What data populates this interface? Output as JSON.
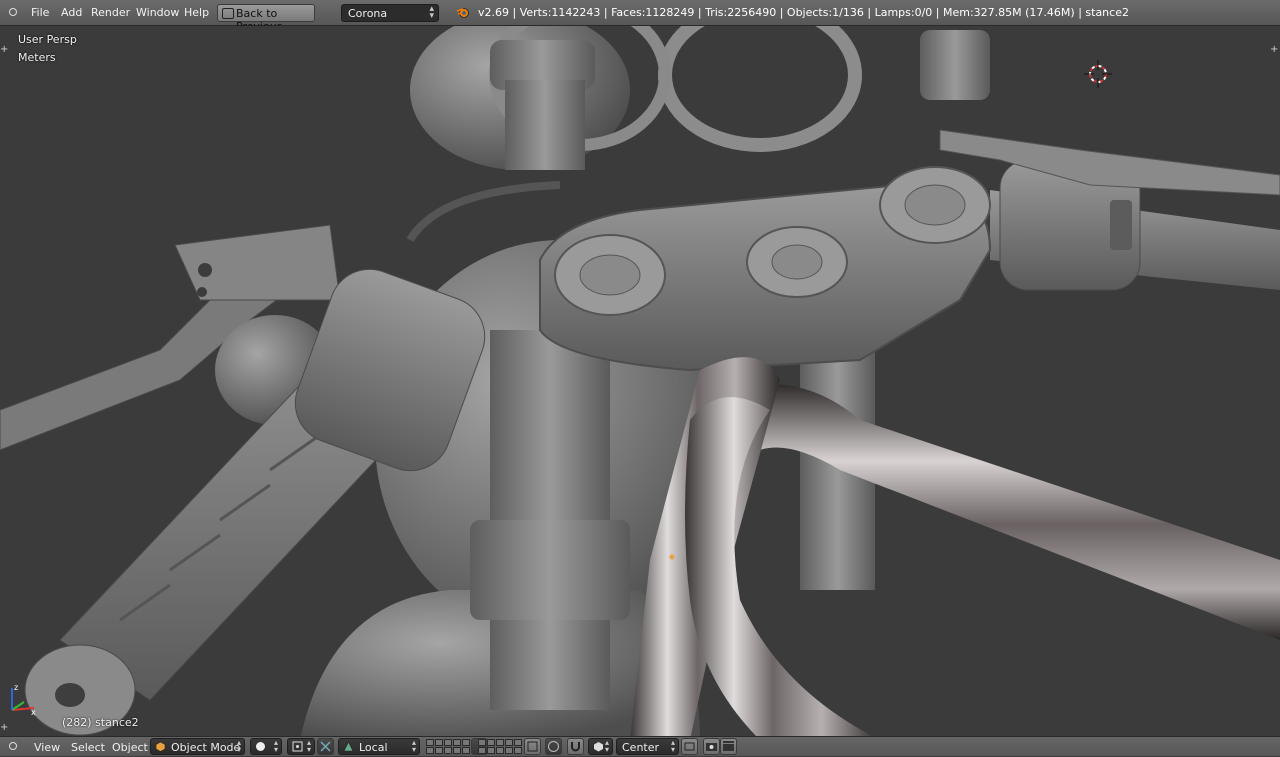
{
  "menu": [
    "File",
    "Add",
    "Render",
    "Window",
    "Help"
  ],
  "back_button": "Back to Previous",
  "render_engine": "Corona",
  "stats": "v2.69 | Verts:1142243 | Faces:1128249 | Tris:2256490 | Objects:1/136 | Lamps:0/0 | Mem:327.85M (17.46M) | stance2",
  "viewport": {
    "view_name": "User Persp",
    "units": "Meters",
    "frame_object": "(282) stance2"
  },
  "view3d_header": {
    "menus": [
      "View",
      "Select",
      "Object"
    ],
    "mode": "Object Mode",
    "orientation": "Local",
    "pivot": "Center"
  },
  "colors": {
    "header_bg": "#5f5f5f",
    "viewport_bg": "#3b3b3b",
    "model_grey": "#7d7d7d",
    "cursor_red": "#d03030"
  }
}
